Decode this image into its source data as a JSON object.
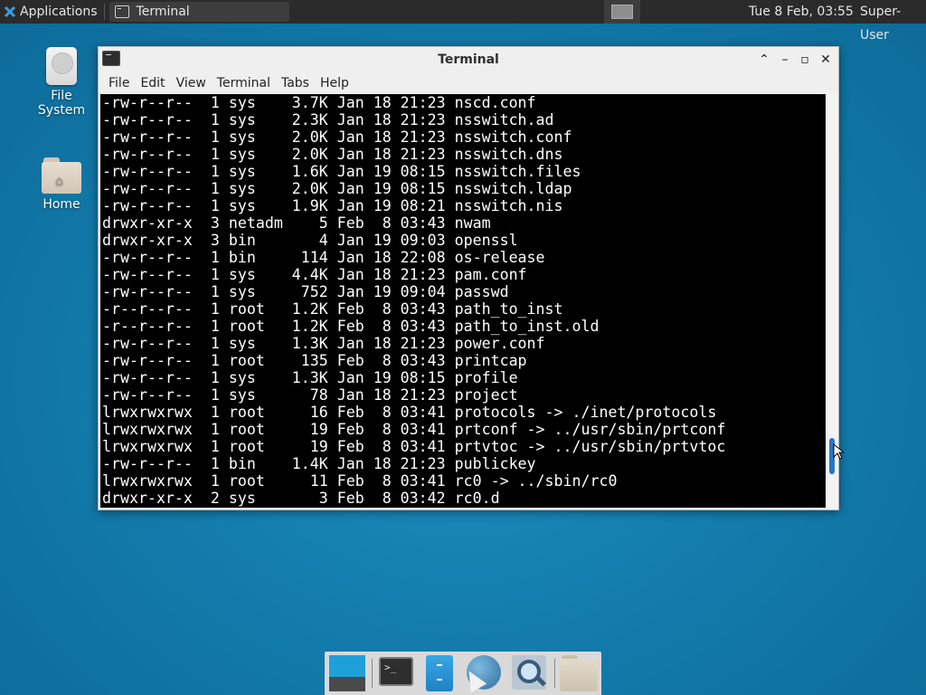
{
  "top_panel": {
    "applications_label": "Applications",
    "task_title": "Terminal",
    "clock": "Tue  8 Feb, 03:55",
    "user": "Super-User"
  },
  "desktop": {
    "icons": [
      {
        "label": "File System",
        "icon": "drive-icon"
      },
      {
        "label": "Home",
        "icon": "home-folder-icon"
      }
    ]
  },
  "window": {
    "title": "Terminal",
    "menu": [
      "File",
      "Edit",
      "View",
      "Terminal",
      "Tabs",
      "Help"
    ],
    "terminal_lines": [
      "-rw-r--r--  1 sys    3.7K Jan 18 21:23 nscd.conf",
      "-rw-r--r--  1 sys    2.3K Jan 18 21:23 nsswitch.ad",
      "-rw-r--r--  1 sys    2.0K Jan 18 21:23 nsswitch.conf",
      "-rw-r--r--  1 sys    2.0K Jan 18 21:23 nsswitch.dns",
      "-rw-r--r--  1 sys    1.6K Jan 19 08:15 nsswitch.files",
      "-rw-r--r--  1 sys    2.0K Jan 19 08:15 nsswitch.ldap",
      "-rw-r--r--  1 sys    1.9K Jan 19 08:21 nsswitch.nis",
      "drwxr-xr-x  3 netadm    5 Feb  8 03:43 nwam",
      "drwxr-xr-x  3 bin       4 Jan 19 09:03 openssl",
      "-rw-r--r--  1 bin     114 Jan 18 22:08 os-release",
      "-rw-r--r--  1 sys    4.4K Jan 18 21:23 pam.conf",
      "-rw-r--r--  1 sys     752 Jan 19 09:04 passwd",
      "-r--r--r--  1 root   1.2K Feb  8 03:43 path_to_inst",
      "-r--r--r--  1 root   1.2K Feb  8 03:43 path_to_inst.old",
      "-rw-r--r--  1 sys    1.3K Jan 18 21:23 power.conf",
      "-rw-r--r--  1 root    135 Feb  8 03:43 printcap",
      "-rw-r--r--  1 sys    1.3K Jan 19 08:15 profile",
      "-rw-r--r--  1 sys      78 Jan 18 21:23 project",
      "lrwxrwxrwx  1 root     16 Feb  8 03:41 protocols -> ./inet/protocols",
      "lrwxrwxrwx  1 root     19 Feb  8 03:41 prtconf -> ../usr/sbin/prtconf",
      "lrwxrwxrwx  1 root     19 Feb  8 03:41 prtvtoc -> ../usr/sbin/prtvtoc",
      "-rw-r--r--  1 bin    1.4K Jan 18 21:23 publickey",
      "lrwxrwxrwx  1 root     11 Feb  8 03:41 rc0 -> ../sbin/rc0",
      "drwxr-xr-x  2 sys       3 Feb  8 03:42 rc0.d"
    ]
  },
  "dock": {
    "items": [
      "show-desktop-icon",
      "terminal-icon",
      "file-manager-icon",
      "web-browser-icon",
      "search-icon",
      "folder-icon"
    ]
  },
  "colors": {
    "desktop_bg": "#147fb0",
    "panel_bg": "#2b2b2b",
    "terminal_bg": "#000000",
    "terminal_fg": "#ffffff",
    "scroll_thumb": "#2a75c4"
  }
}
